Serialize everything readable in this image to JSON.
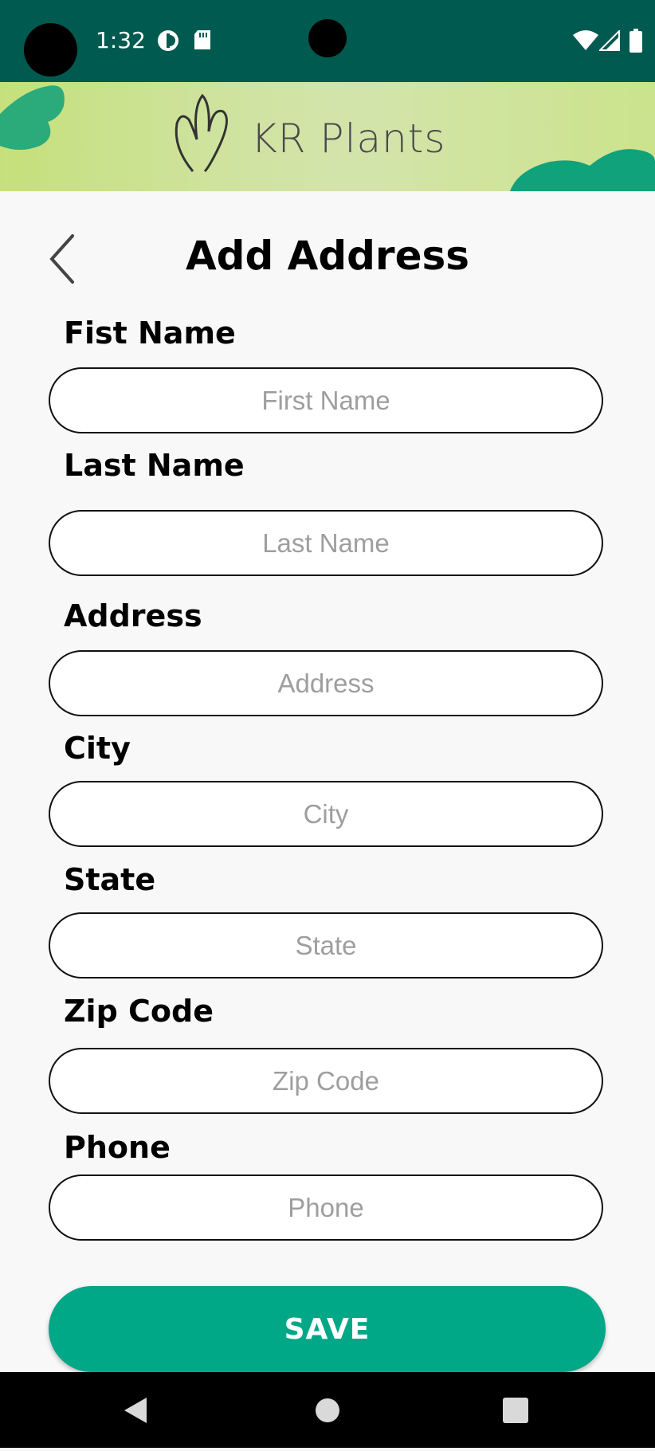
{
  "status_bar": {
    "time": "1:32",
    "icons": [
      "notification-app-icon",
      "sd-card-icon",
      "wifi-icon",
      "signal-icon",
      "battery-icon"
    ],
    "background": "#015a4f"
  },
  "banner": {
    "brand": "KR Plants"
  },
  "header": {
    "title": "Add Address"
  },
  "form": {
    "fields": [
      {
        "label": "Fist Name",
        "placeholder": "First Name",
        "value": ""
      },
      {
        "label": "Last Name",
        "placeholder": "Last Name",
        "value": ""
      },
      {
        "label": "Address",
        "placeholder": "Address",
        "value": ""
      },
      {
        "label": "City",
        "placeholder": "City",
        "value": ""
      },
      {
        "label": "State",
        "placeholder": "State",
        "value": ""
      },
      {
        "label": "Zip Code",
        "placeholder": "Zip Code",
        "value": ""
      },
      {
        "label": "Phone",
        "placeholder": "Phone",
        "value": ""
      }
    ],
    "save_label": "SAVE",
    "accent": "#00a887"
  },
  "nav": {
    "buttons": [
      "back-icon",
      "home-icon",
      "recents-icon"
    ]
  }
}
